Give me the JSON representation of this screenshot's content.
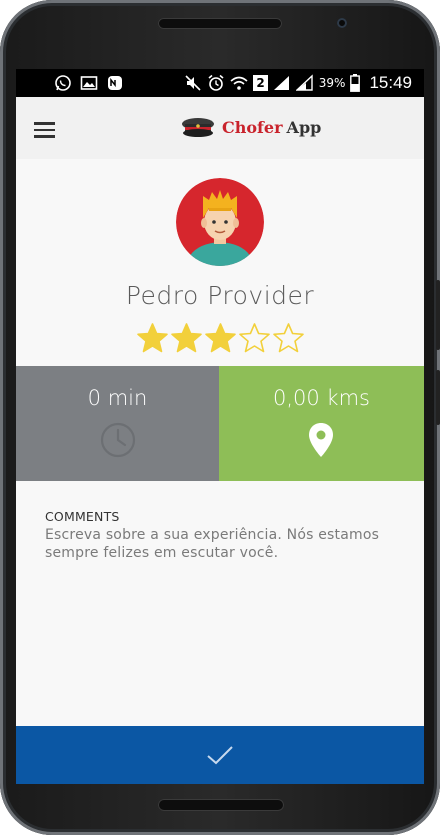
{
  "status_bar": {
    "battery_percent": "39%",
    "time": "15:49",
    "sim_label": "2",
    "icons": [
      "whatsapp-icon",
      "gallery-icon",
      "nubank-icon",
      "mute-icon",
      "alarm-icon",
      "wifi-icon",
      "signal-icon",
      "battery-icon"
    ]
  },
  "app_bar": {
    "brand": "Chofer",
    "app": "App",
    "menu_icon": "menu-icon"
  },
  "profile": {
    "name": "Pedro Provider",
    "rating": 3,
    "max_rating": 5
  },
  "stats": {
    "time_value": "0 min",
    "time_icon": "clock-icon",
    "distance_value": "0,00 kms",
    "distance_icon": "location-pin-icon"
  },
  "comments": {
    "label": "COMMENTS",
    "placeholder": "Escreva sobre a sua experiência. Nós estamos sempre felizes em escutar você."
  },
  "confirm": {
    "icon": "checkmark-icon"
  },
  "colors": {
    "app_bar_bg": "#f1f1f1",
    "stat_time_bg": "#7c7f83",
    "stat_distance_bg": "#8ebe57",
    "confirm_bg": "#0b57a4",
    "star": "#f2d03b",
    "brand_red": "#c9232c"
  }
}
